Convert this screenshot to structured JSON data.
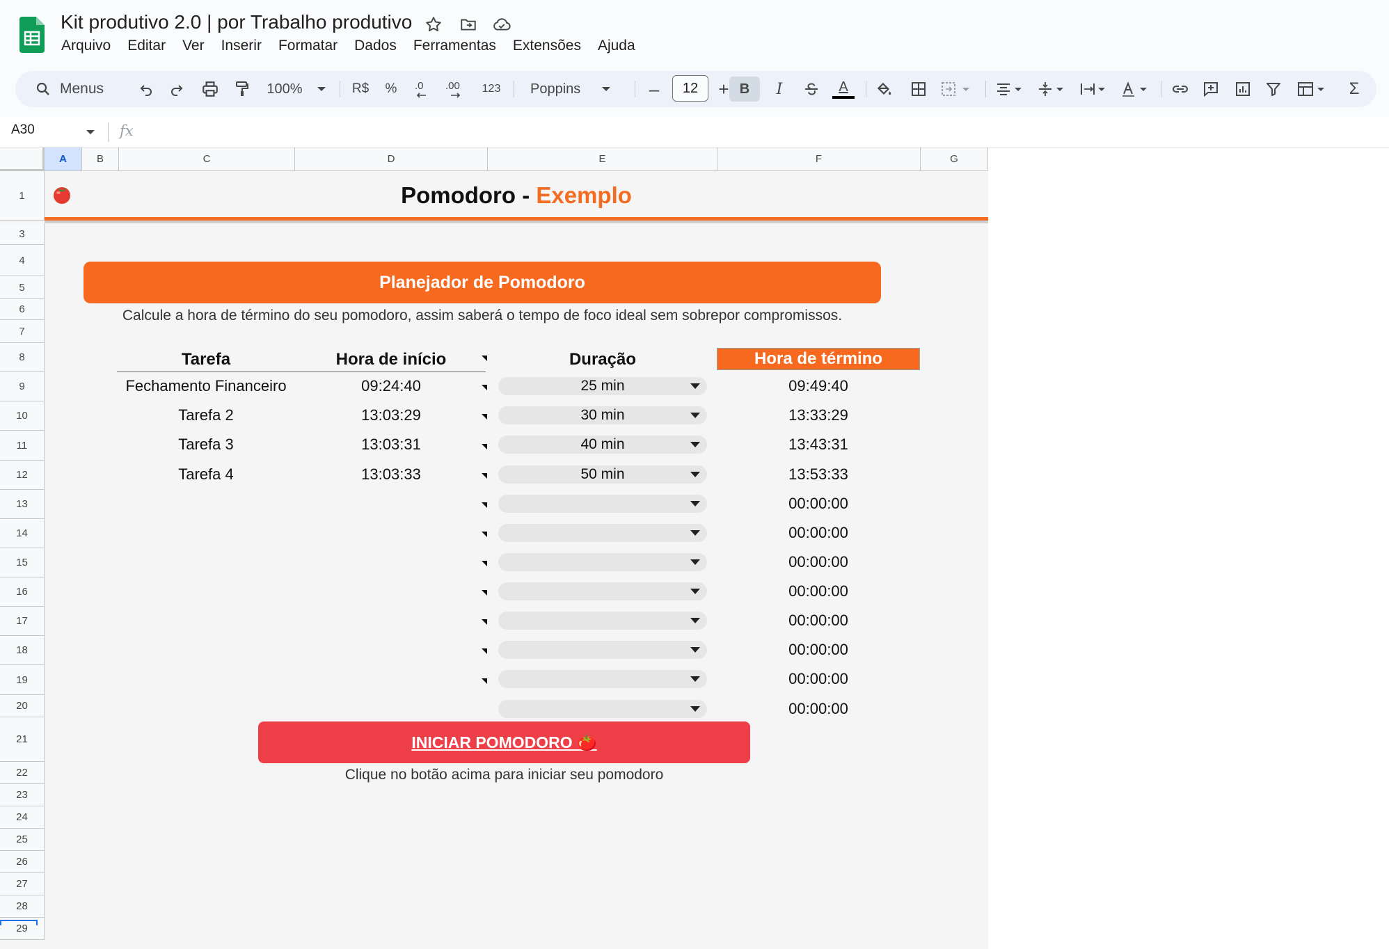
{
  "window": {
    "doc_title": "Kit produtivo 2.0 | por Trabalho produtivo",
    "menu": [
      "Arquivo",
      "Editar",
      "Ver",
      "Inserir",
      "Formatar",
      "Dados",
      "Ferramentas",
      "Extensões",
      "Ajuda"
    ]
  },
  "toolbar": {
    "menus_label": "Menus",
    "zoom": "100%",
    "currency": "R$",
    "percent": "%",
    "decrease_decimals": ".0",
    "increase_decimals": ".00",
    "number_format": "123",
    "font": "Poppins",
    "font_size": "12",
    "bold": "B",
    "italic": "I",
    "text_color": "A",
    "minus": "–",
    "plus": "+",
    "sum": "Σ"
  },
  "formula_bar": {
    "name_box": "A30",
    "fx": "fx"
  },
  "columns": [
    "A",
    "B",
    "C",
    "D",
    "E",
    "F",
    "G"
  ],
  "rows": [
    "1",
    "3",
    "4",
    "5",
    "6",
    "7",
    "8",
    "9",
    "10",
    "11",
    "12",
    "13",
    "14",
    "15",
    "16",
    "17",
    "18",
    "19",
    "20",
    "21",
    "22",
    "23",
    "24",
    "25",
    "26",
    "27",
    "28",
    "29"
  ],
  "sheet": {
    "title_main": "Pomodoro - ",
    "title_accent": "Exemplo",
    "planner_title": "Planejador de Pomodoro",
    "planner_description": "Calcule a hora de término do seu pomodoro, assim saberá o tempo de foco ideal sem sobrepor compromissos.",
    "headers": {
      "task": "Tarefa",
      "start": "Hora de início",
      "duration": "Duração",
      "end": "Hora de término"
    },
    "tasks": [
      {
        "task": "Fechamento Financeiro",
        "start": "09:24:40",
        "duration": "25 min",
        "end": "09:49:40"
      },
      {
        "task": "Tarefa 2",
        "start": "13:03:29",
        "duration": "30 min",
        "end": "13:33:29"
      },
      {
        "task": "Tarefa 3",
        "start": "13:03:31",
        "duration": "40 min",
        "end": "13:43:31"
      },
      {
        "task": "Tarefa 4",
        "start": "13:03:33",
        "duration": "50 min",
        "end": "13:53:33"
      },
      {
        "task": "",
        "start": "",
        "duration": "",
        "end": "00:00:00"
      },
      {
        "task": "",
        "start": "",
        "duration": "",
        "end": "00:00:00"
      },
      {
        "task": "",
        "start": "",
        "duration": "",
        "end": "00:00:00"
      },
      {
        "task": "",
        "start": "",
        "duration": "",
        "end": "00:00:00"
      },
      {
        "task": "",
        "start": "",
        "duration": "",
        "end": "00:00:00"
      },
      {
        "task": "",
        "start": "",
        "duration": "",
        "end": "00:00:00"
      },
      {
        "task": "",
        "start": "",
        "duration": "",
        "end": "00:00:00"
      },
      {
        "task": "",
        "start": "",
        "duration": "",
        "end": "00:00:00"
      }
    ],
    "start_button": "INICIAR POMODORO 🍅",
    "start_hint": "Clique no botão acima para iniciar seu pomodoro"
  },
  "colors": {
    "accent_orange": "#f7691f",
    "start_red": "#ee3f48",
    "sheets_green": "#0f9d58"
  }
}
